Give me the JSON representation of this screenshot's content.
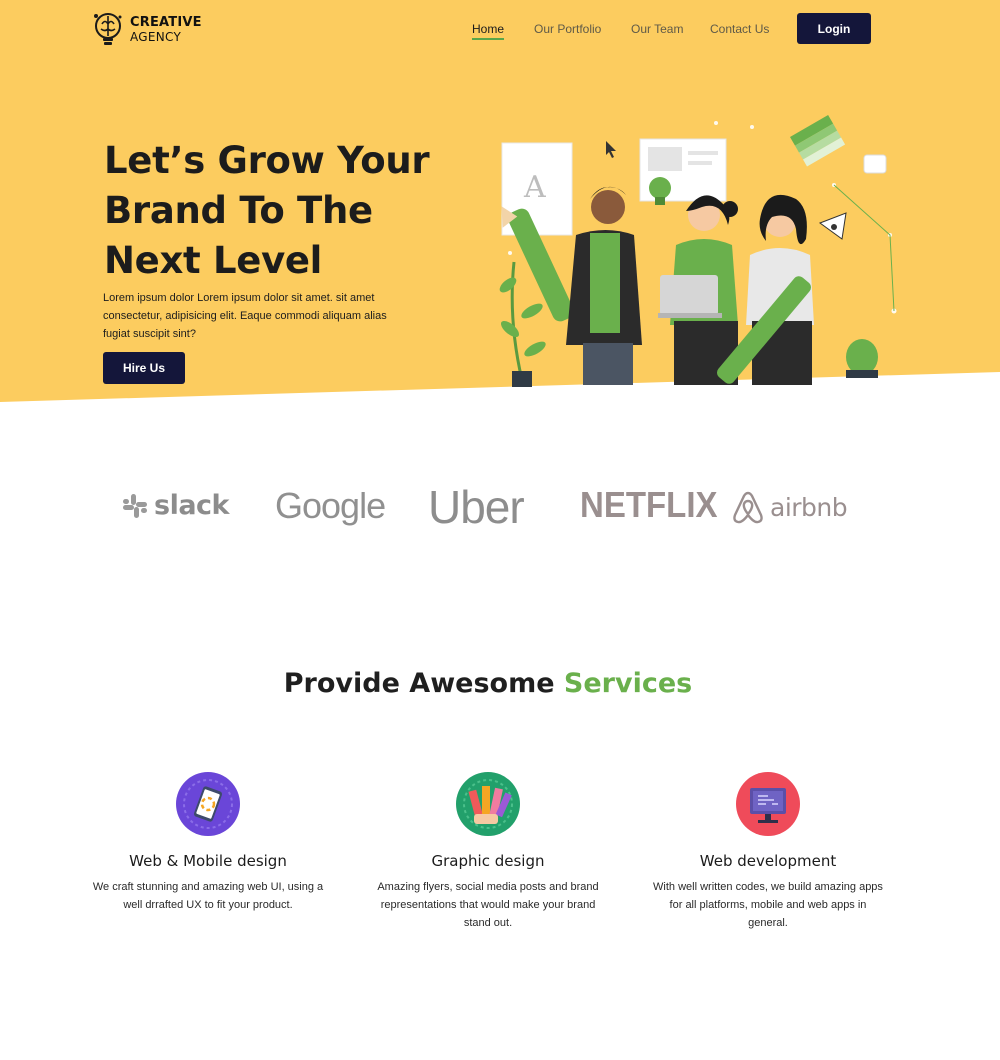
{
  "brand": {
    "line1": "CREATIVE",
    "line2": "AGENCY"
  },
  "nav": {
    "links": [
      {
        "label": "Home",
        "active": true
      },
      {
        "label": "Our Portfolio",
        "active": false
      },
      {
        "label": "Our Team",
        "active": false
      },
      {
        "label": "Contact Us",
        "active": false
      }
    ],
    "login_label": "Login"
  },
  "hero": {
    "title_line1": "Let’s Grow Your",
    "title_line2": "Brand To The",
    "title_line3": "Next Level",
    "subtitle": "Lorem ipsum dolor Lorem ipsum dolor sit amet. sit amet consectetur, adipisicing elit. Eaque commodi aliquam alias fugiat suscipit sint?",
    "cta_label": "Hire Us",
    "illustration_letter": "A"
  },
  "logos": {
    "slack": "slack",
    "google": "Google",
    "uber": "Uber",
    "netflix": "NETFLIX",
    "airbnb": "airbnb"
  },
  "services": {
    "title_main": "Provide Awesome ",
    "title_accent": "Services",
    "items": [
      {
        "name": "Web & Mobile design",
        "desc": "We craft stunning and amazing web UI, using a well drrafted UX to fit your product.",
        "icon": "mobile-design-icon"
      },
      {
        "name": "Graphic design",
        "desc": "Amazing flyers, social media posts and brand representations that would make your brand stand out.",
        "icon": "color-swatch-icon"
      },
      {
        "name": "Web development",
        "desc": "With well written codes, we build amazing apps for all platforms, mobile and web apps in general.",
        "icon": "code-monitor-icon"
      }
    ]
  },
  "colors": {
    "hero_bg": "#fccc5f",
    "dark_navy": "#14163a",
    "accent_green": "#6ab04c",
    "logo_gray": "#8c8c8c"
  }
}
